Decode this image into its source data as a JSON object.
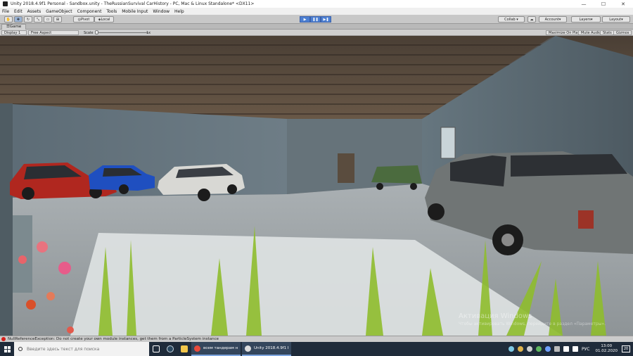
{
  "window": {
    "title": "Unity 2018.4.9f1 Personal - Sandbox.unity - TheRussianSurvival CarHistory - PC, Mac & Linux Standalone* <DX11>",
    "controls": [
      "—",
      "☐",
      "✕"
    ]
  },
  "menu": [
    "File",
    "Edit",
    "Assets",
    "GameObject",
    "Component",
    "Tools",
    "Mobile Input",
    "Window",
    "Help"
  ],
  "toolbar": {
    "pivot_label": "Pivot",
    "local_label": "Local",
    "collab_label": "Collab ▾",
    "account_label": "Account",
    "layers_label": "Layers",
    "layout_label": "Layout",
    "play_glyphs": [
      "▶",
      "❚❚",
      "▶❚"
    ]
  },
  "game_tab": {
    "label": "Game",
    "display": "Display 1",
    "aspect": "Free Aspect",
    "scale_label": "Scale",
    "scale_value": "1x",
    "maximize": "Maximize On Play",
    "mute": "Mute Audio",
    "stats": "Stats",
    "gizmos": "Gizmos"
  },
  "watermark": {
    "line1": "Активация Windows",
    "line2": "Чтобы активировать Windows, перейдите в раздел «Параметры»."
  },
  "console": {
    "message": "NullReferenceException: Do not create your own module instances, get them from a ParticleSystem instance"
  },
  "taskbar": {
    "search_placeholder": "Введите здесь текст для поиска",
    "apps": [
      {
        "label": "всем тандерам на ...",
        "color": "#e84a3c"
      },
      {
        "label": "Unity 2018.4.9f1 Per...",
        "color": "#dddddd"
      }
    ],
    "language": "РУС",
    "time": "13:00",
    "date": "01.02.2020",
    "notifications": "20"
  }
}
